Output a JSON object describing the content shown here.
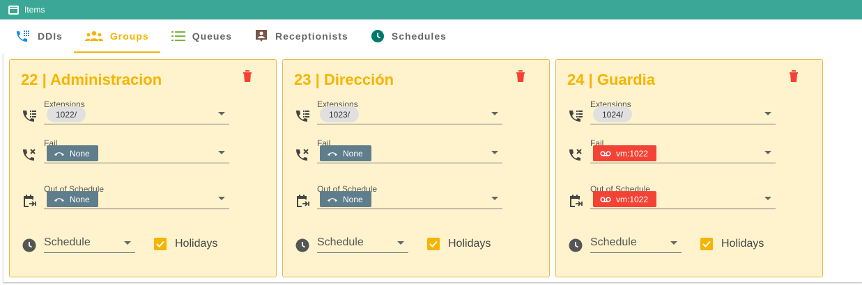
{
  "window": {
    "title": "Items"
  },
  "tabs": [
    {
      "label": "DDIs",
      "icon": "ddi-phone-icon",
      "active": false
    },
    {
      "label": "Groups",
      "icon": "groups-icon",
      "active": true
    },
    {
      "label": "Queues",
      "icon": "queues-list-icon",
      "active": false
    },
    {
      "label": "Receptionists",
      "icon": "receptionist-icon",
      "active": false
    },
    {
      "label": "Schedules",
      "icon": "clock-icon",
      "active": false
    }
  ],
  "colors": {
    "titlebar": "#3ba796",
    "accent": "#f6b400",
    "card_bg": "#fff3cd",
    "delete": "#f44336",
    "none_chip": "#607d8b",
    "vm_chip": "#f44336"
  },
  "labels": {
    "extensions": "Extensions",
    "fail": "Fail",
    "out_of_schedule": "Out of Schedule",
    "schedule": "Schedule",
    "holidays": "Holidays"
  },
  "groups": [
    {
      "title": "22 | Administracion",
      "extension": "1022/",
      "fail": "None",
      "fail_type": "none",
      "out_of_schedule": "None",
      "oos_type": "none",
      "holidays_checked": true
    },
    {
      "title": "23 | Dirección",
      "extension": "1023/",
      "fail": "None",
      "fail_type": "none",
      "out_of_schedule": "None",
      "oos_type": "none",
      "holidays_checked": true
    },
    {
      "title": "24 | Guardia",
      "extension": "1024/",
      "fail": "vm:1022",
      "fail_type": "vm",
      "out_of_schedule": "vm:1022",
      "oos_type": "vm",
      "holidays_checked": true
    }
  ]
}
